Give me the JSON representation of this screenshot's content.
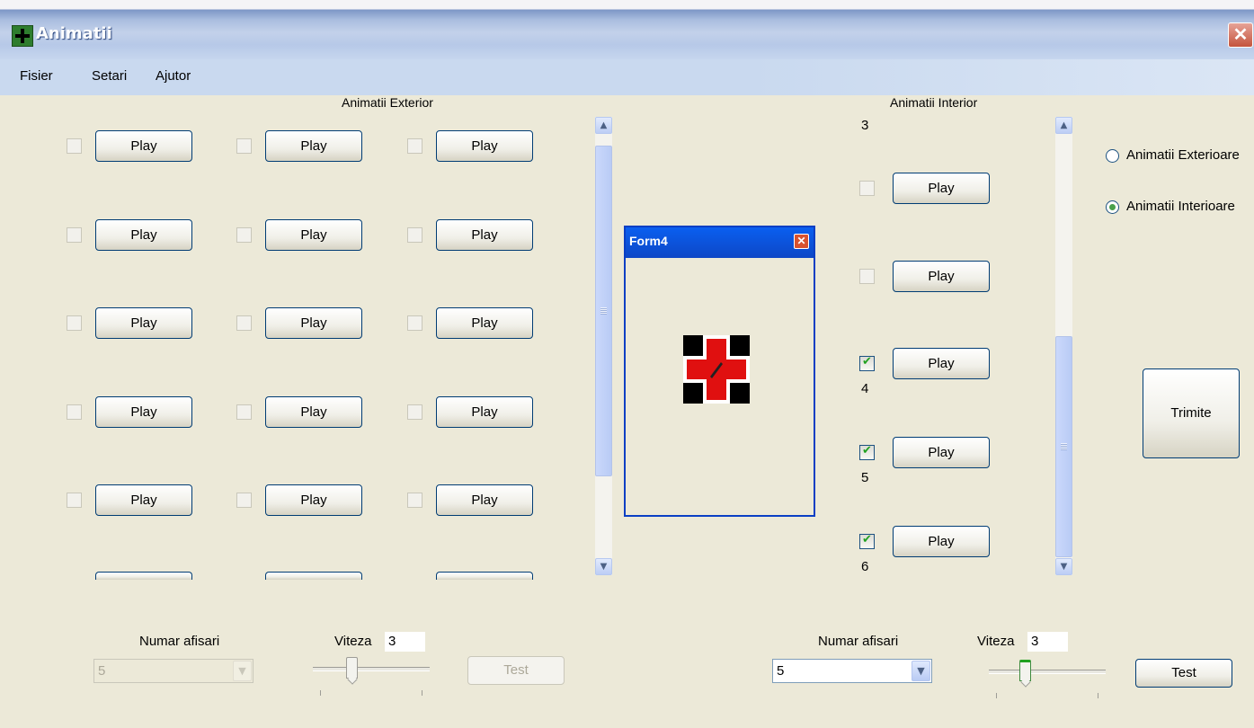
{
  "window": {
    "title": "Animatii"
  },
  "menu": [
    "Fisier",
    "Setari",
    "Ajutor"
  ],
  "exterior": {
    "label": "Animatii Exterior",
    "play_label": "Play",
    "rows": 5,
    "cols": 3,
    "bottom": {
      "count_label": "Numar afisari",
      "count_value": "5",
      "speed_label": "Viteza",
      "speed_value": "3",
      "test_label": "Test"
    }
  },
  "interior": {
    "label": "Animatii Interior",
    "top_number": "3",
    "items": [
      {
        "checked": false,
        "play": "Play",
        "number": ""
      },
      {
        "checked": false,
        "play": "Play",
        "number": ""
      },
      {
        "checked": true,
        "play": "Play",
        "number": "4"
      },
      {
        "checked": true,
        "play": "Play",
        "number": "5"
      },
      {
        "checked": true,
        "play": "Play",
        "number": "6"
      }
    ],
    "bottom": {
      "count_label": "Numar afisari",
      "count_value": "5",
      "speed_label": "Viteza",
      "speed_value": "3",
      "test_label": "Test"
    }
  },
  "options": {
    "radio_exterior": "Animatii Exterioare",
    "radio_interior": "Animatii Interioare",
    "selected": "interior"
  },
  "send_button": "Trimite",
  "form4": {
    "title": "Form4",
    "close_glyph": "✕"
  },
  "icons": {
    "app": "green-cross-icon",
    "logo": "red-cross-logo-icon"
  }
}
